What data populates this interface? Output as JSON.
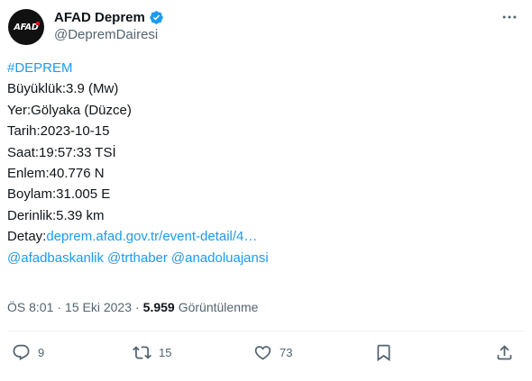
{
  "author": {
    "display_name": "AFAD Deprem",
    "handle": "@DepremDairesi",
    "avatar_text": "AFAD"
  },
  "tweet": {
    "hashtag": "#DEPREM",
    "lines": [
      "Büyüklük:3.9 (Mw)",
      "Yer:Gölyaka (Düzce)",
      "Tarih:2023-10-15",
      "Saat:19:57:33 TSİ",
      "Enlem:40.776 N",
      "Boylam:31.005 E",
      "Derinlik:5.39 km"
    ],
    "detail_label": "Detay:",
    "detail_link": "deprem.afad.gov.tr/event-detail/4…",
    "mentions": [
      "@afadbaskanlik",
      "@trthaber",
      "@anadoluajansi"
    ]
  },
  "meta": {
    "time": "ÖS 8:01",
    "separator": "·",
    "date": "15 Eki 2023",
    "views_count": "5.959",
    "views_label": "Görüntülenme"
  },
  "actions": {
    "replies": "9",
    "retweets": "15",
    "likes": "73"
  },
  "colors": {
    "link": "#1d9bf0",
    "secondary_text": "#536471",
    "primary_text": "#0f1419",
    "avatar_bg": "#111111",
    "verified": "#1d9bf0"
  },
  "icons": [
    "verified-badge-icon",
    "more-options-icon",
    "reply-icon",
    "retweet-icon",
    "like-icon",
    "bookmark-icon",
    "share-icon"
  ]
}
